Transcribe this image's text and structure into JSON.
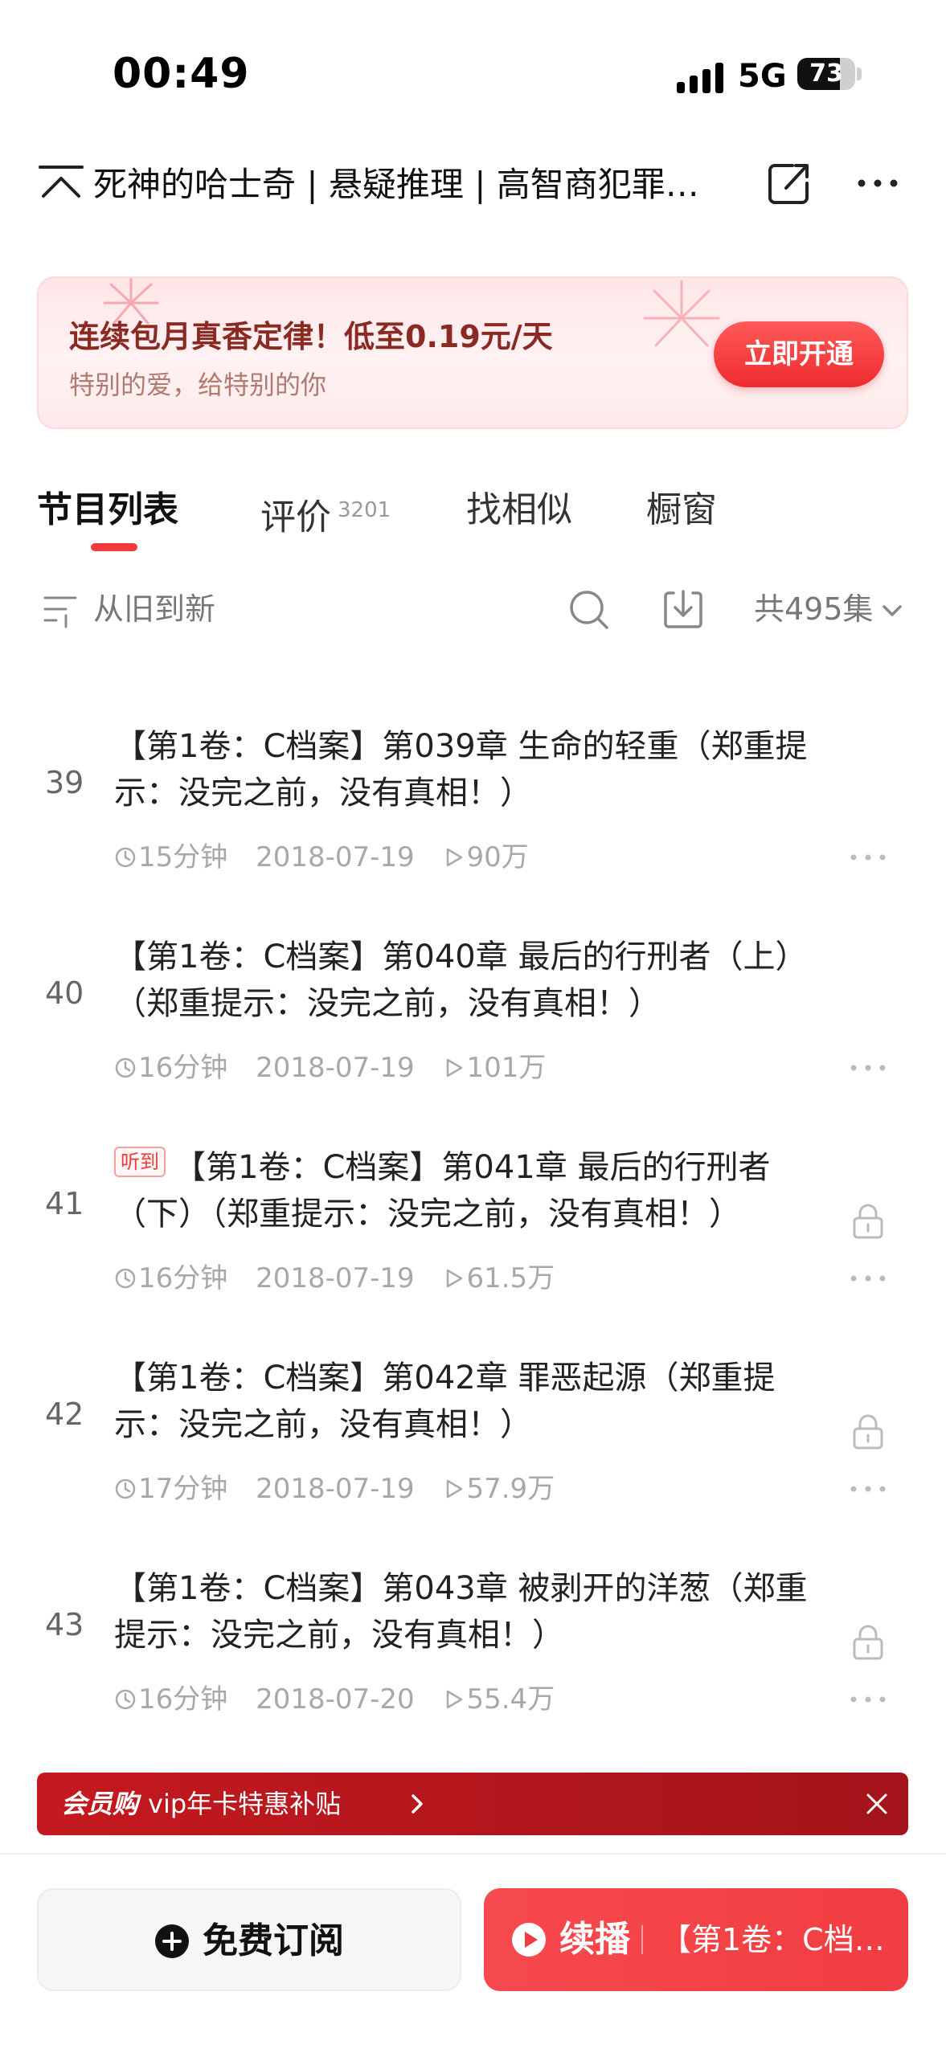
{
  "status": {
    "time": "00:49",
    "network": "5G",
    "battery": "73",
    "battery_level": 0.73
  },
  "header": {
    "title": "死神的哈士奇 | 悬疑推理 | 高智商犯罪…",
    "icons": [
      "collapse-icon",
      "share-icon",
      "more-icon"
    ]
  },
  "promo": {
    "title": "连续包月真香定律！低至0.19元/天",
    "subtitle": "特别的爱，给特别的你",
    "button": "立即开通"
  },
  "tabs": [
    {
      "label": "节目列表",
      "count": ""
    },
    {
      "label": "评价",
      "count": "3201"
    },
    {
      "label": "找相似",
      "count": ""
    },
    {
      "label": "橱窗",
      "count": ""
    }
  ],
  "toolbar": {
    "sort": "从旧到新",
    "count": "共495集"
  },
  "episodes": [
    {
      "num": "39",
      "tag": "",
      "title": "【第1卷：C档案】第039章 生命的轻重（郑重提示：没完之前，没有真相！）",
      "duration": "15分钟",
      "date": "2018-07-19",
      "plays": "90万",
      "locked": false
    },
    {
      "num": "40",
      "tag": "",
      "title": "【第1卷：C档案】第040章 最后的行刑者（上）（郑重提示：没完之前，没有真相！）",
      "duration": "16分钟",
      "date": "2018-07-19",
      "plays": "101万",
      "locked": false
    },
    {
      "num": "41",
      "tag": "听到",
      "title": "【第1卷：C档案】第041章 最后的行刑者（下）（郑重提示：没完之前，没有真相！）",
      "duration": "16分钟",
      "date": "2018-07-19",
      "plays": "61.5万",
      "locked": true
    },
    {
      "num": "42",
      "tag": "",
      "title": "【第1卷：C档案】第042章 罪恶起源（郑重提示：没完之前，没有真相！）",
      "duration": "17分钟",
      "date": "2018-07-19",
      "plays": "57.9万",
      "locked": true
    },
    {
      "num": "43",
      "tag": "",
      "title": "【第1卷：C档案】第043章 被剥开的洋葱（郑重提示：没完之前，没有真相！）",
      "duration": "16分钟",
      "date": "2018-07-20",
      "plays": "55.4万",
      "locked": true
    }
  ],
  "vip": {
    "brand": "会员购",
    "text": "vip年卡特惠补贴"
  },
  "bottom": {
    "subscribe": "免费订阅",
    "play": "续播",
    "play_episode": "【第1卷：C档…"
  },
  "colors": {
    "accent": "#f23a3d",
    "vip": "#b3161c",
    "promo_bg": "#ffe6e8"
  }
}
